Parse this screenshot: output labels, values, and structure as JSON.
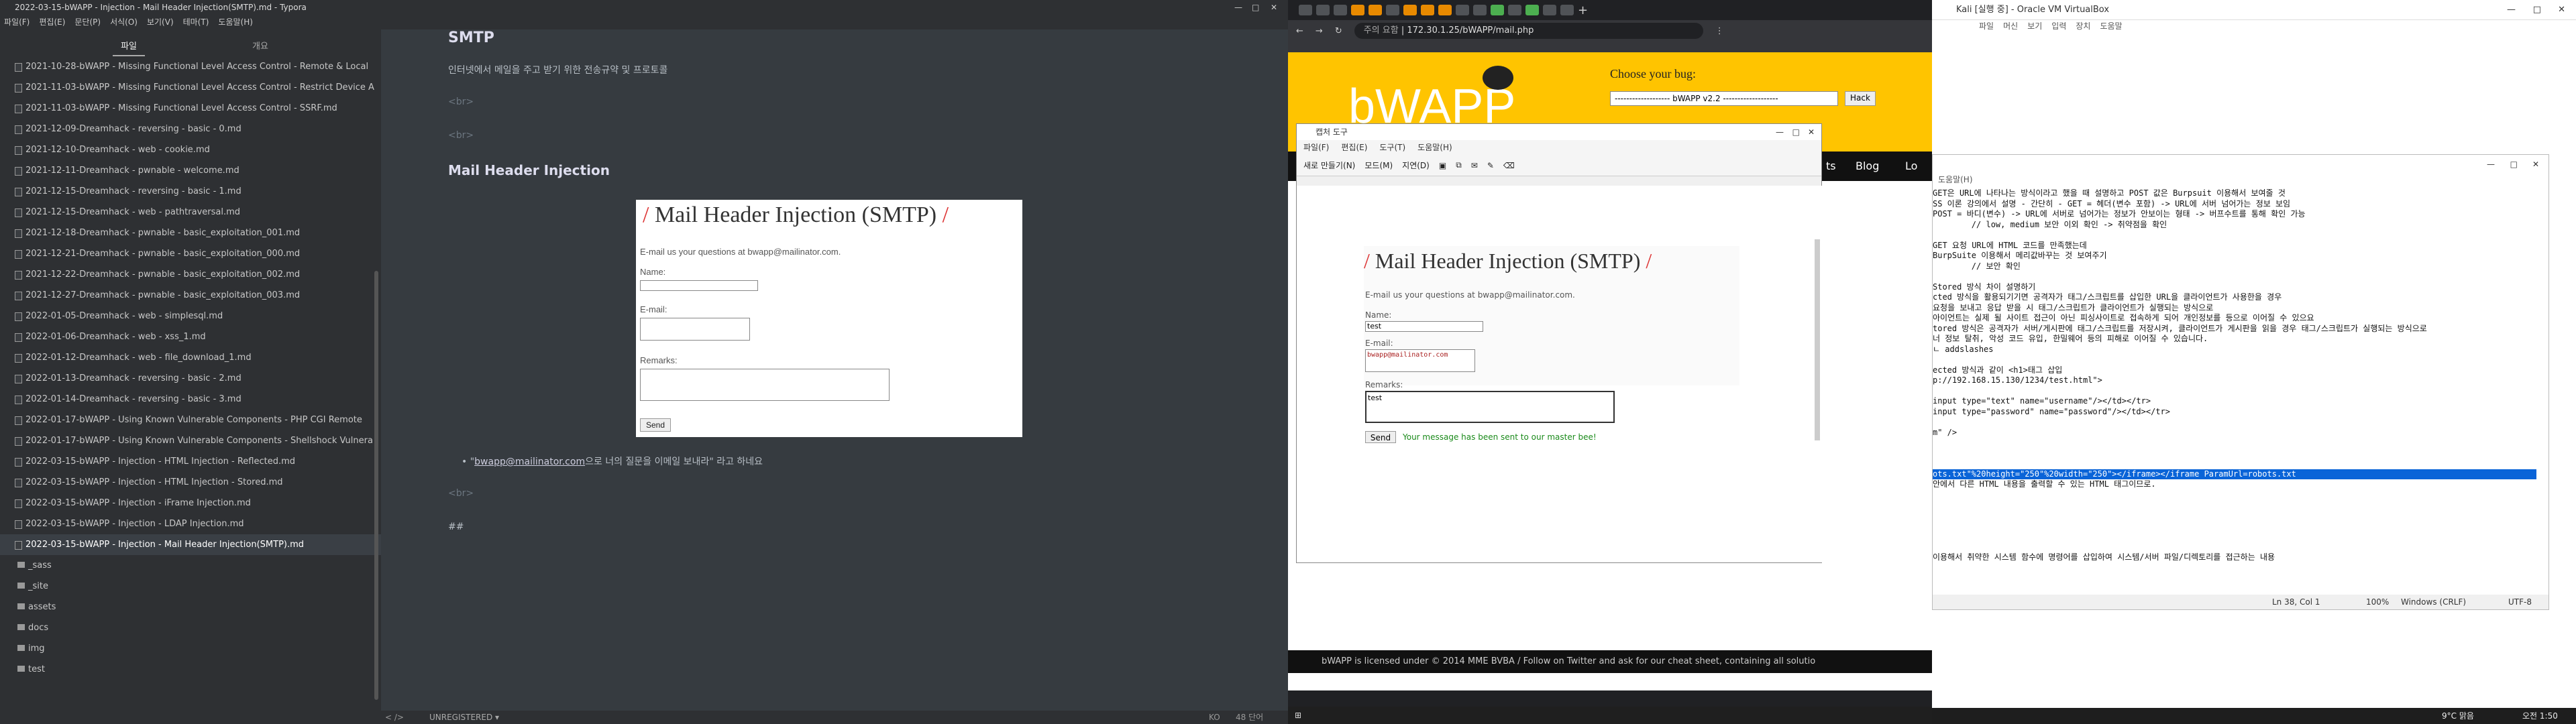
{
  "typora": {
    "title": "2022-03-15-bWAPP - Injection - Mail Header Injection(SMTP).md - Typora",
    "menu": [
      "파일(F)",
      "편집(E)",
      "문단(P)",
      "서식(O)",
      "보기(V)",
      "테마(T)",
      "도움말(H)"
    ],
    "tabs": {
      "files": "파일",
      "outline": "개요"
    },
    "files": [
      "2021-10-28-bWAPP - Missing Functional Level Access Control - Remote & Local",
      "2021-11-03-bWAPP - Missing Functional Level Access Control - Restrict Device A",
      "2021-11-03-bWAPP - Missing Functional Level Access Control - SSRF.md",
      "2021-12-09-Dreamhack - reversing - basic - 0.md",
      "2021-12-10-Dreamhack - web - cookie.md",
      "2021-12-11-Dreamhack - pwnable - welcome.md",
      "2021-12-15-Dreamhack - reversing - basic - 1.md",
      "2021-12-15-Dreamhack - web - pathtraversal.md",
      "2021-12-18-Dreamhack - pwnable - basic_exploitation_001.md",
      "2021-12-21-Dreamhack - pwnable - basic_exploitation_000.md",
      "2021-12-22-Dreamhack - pwnable - basic_exploitation_002.md",
      "2021-12-27-Dreamhack - pwnable - basic_exploitation_003.md",
      "2022-01-05-Dreamhack - web - simplesql.md",
      "2022-01-06-Dreamhack - web - xss_1.md",
      "2022-01-12-Dreamhack - web - file_download_1.md",
      "2022-01-13-Dreamhack - reversing - basic - 2.md",
      "2022-01-14-Dreamhack - reversing - basic - 3.md",
      "2022-01-17-bWAPP - Using Known Vulnerable Components - PHP CGI Remote",
      "2022-01-17-bWAPP - Using Known Vulnerable Components - Shellshock Vulnera",
      "2022-03-15-bWAPP - Injection - HTML Injection - Reflected.md",
      "2022-03-15-bWAPP - Injection - HTML Injection - Stored.md",
      "2022-03-15-bWAPP - Injection - iFrame Injection.md",
      "2022-03-15-bWAPP - Injection - LDAP Injection.md",
      "2022-03-15-bWAPP - Injection - Mail Header Injection(SMTP).md"
    ],
    "folders": [
      "_sass",
      "_site",
      "assets",
      "docs",
      "img",
      "test"
    ],
    "editor": {
      "heading1": "SMTP",
      "para1": "인터넷에서 메일을 주고 받기 위한 전송규약 및 프로토콜",
      "br": "<br>",
      "heading2": "Mail Header Injection",
      "bullet_link": "bwapp@mailinator.com",
      "bullet_rest": "으로 너의 질문을 이메일 보내라\" 라고 하네요",
      "bullet_quote": "\"",
      "hash": "##"
    },
    "status": {
      "left": "<  />",
      "mode": "UNREGISTERED ▾",
      "ko": "KO",
      "words": "48 단어"
    }
  },
  "bwapp_shot": {
    "heading": "Mail Header Injection (SMTP)",
    "intro": "E-mail us your questions at bwapp@mailinator.com.",
    "name_label": "Name:",
    "email_label": "E-mail:",
    "remarks_label": "Remarks:",
    "send": "Send"
  },
  "chrome": {
    "url_warning": "주의 요함",
    "url": "172.30.1.25/bWAPP/mail.php",
    "logo": "bWAPP",
    "choose_bug": "Choose your bug:",
    "bug_select": "------------------- bWAPP v2.2 -------------------",
    "hack": "Hack",
    "nav": [
      "ts",
      "Blog",
      "Lo"
    ],
    "footer": "bWAPP is licensed under                © 2014 MME BVBA / Follow              on Twitter and ask for our cheat sheet, containing all solutio"
  },
  "snip": {
    "title": "캡처 도구",
    "menu": [
      "파일(F)",
      "편집(E)",
      "도구(T)",
      "도움말(H)"
    ],
    "tools": {
      "new": "새로 만들기(N)",
      "mode": "모드(M)",
      "delay": "지연(D)"
    },
    "name_value": "test",
    "email_value": "bwapp@mailinator.com",
    "remarks_value": "test",
    "success": "Your message has been sent to our master bee!"
  },
  "vbox": {
    "title": "Kali [실행 중] - Oracle VM VirtualBox",
    "menu": [
      "파일",
      "머신",
      "보기",
      "입력",
      "장치",
      "도움말"
    ],
    "np_title": "",
    "np_menu": "도움말(H)",
    "lines": [
      "GET은 URL에 나타나는 방식이라고 했을 때 설명하고 POST 값은 Burpsuit 이용해서 보여줄 것",
      "SS 이론 강의에서 설명 - 간단히 - GET = 헤더(변수 포함) -> URL에 서버 넘어가는 정보 보임",
      "POST = 바디(변수) -> URL에 서버로 넘어가는 정보가 안보이는 형태 -> 버프수트를 통해 확인 가능",
      "        // low, medium 보안 이외 확인 -> 취약점을 확인",
      "",
      "GET 요청 URL에 HTML 코드를 만족했는데",
      "BurpSuite 이용해서 메리값바꾸는 것 보여주기",
      "        // 보안 확인",
      "",
      "Stored 방식 차이 설명하기",
      "cted 방식을 활용되기기면 공격자가 태그/스크립트를 삽입한 URL을 클라이언트가 사용한을 경우",
      "요청을 보내고 응답 받을 시 태그/스크립트가 클라이언트가 실행되는 방식으로",
      "아이언트는 실제 될 사이트 접근이 아닌 피싱사이트로 접속하게 되어 개인정보를 등으로 이어질 수 있으요",
      "tored 방식은 공격자가 서버/게시판에 태그/스크립트를 저장시켜, 클라이언트가 게시판을 읽을 경우 태그/스크립트가 실행되는 방식으로",
      "너 정보 탈취, 악성 코드 유입, 한밀웨어 등의 피해로 이어질 수 있습니다.",
      "ㄴ addslashes",
      "",
      "ected 방식과 같이 <h1>태그 삽입",
      "p://192.168.15.130/1234/test.html\">",
      "",
      "input type=\"text\" name=\"username\"/></td></tr>",
      "input type=\"password\" name=\"password\"/></td></tr>",
      "",
      "m\" />",
      "",
      "",
      "",
      "ots.txt\"%20height=\"250\"%20width=\"250\"></iframe></iframe ParamUrl=robots.txt",
      "안에서 다른 HTML 내용을 출력할 수 있는 HTML 태그이므로.",
      "",
      "",
      "",
      "",
      "",
      "",
      "이용해서 취약한 시스템 함수에 명령어를 삽입하여 시스템/서버 파일/디렉토리를 접근하는 내용"
    ],
    "np_status": {
      "pos": "Ln 38, Col 1",
      "zoom": "100%",
      "eol": "Windows (CRLF)",
      "enc": "UTF-8"
    },
    "clock": "오전 1:50",
    "weather": "9°C 맑음"
  }
}
